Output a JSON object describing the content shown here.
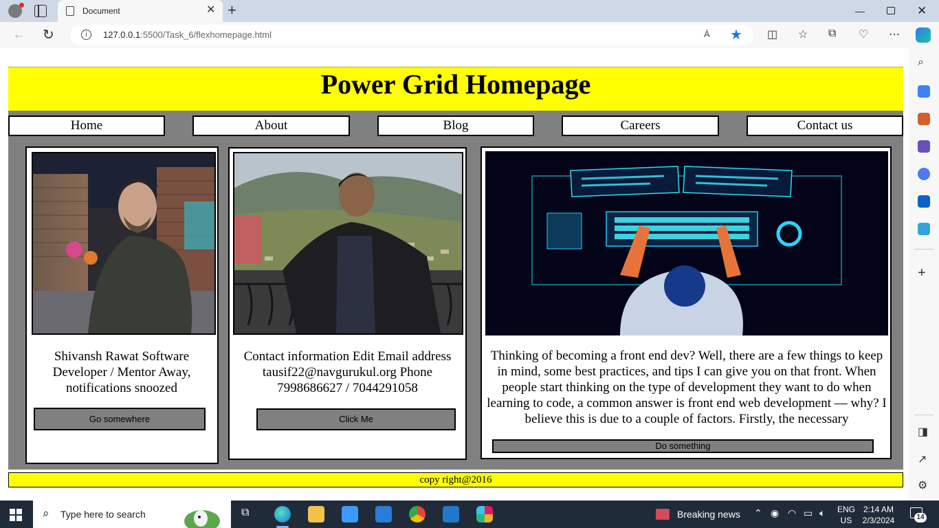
{
  "browser": {
    "tab_title": "Document",
    "url_host": "127.0.0.1",
    "url_rest": ":5500/Task_6/flexhomepage.html",
    "read_aloud_label": "Á"
  },
  "page": {
    "title": "Power Grid Homepage",
    "nav": [
      "Home",
      "About",
      "Blog",
      "Careers",
      "Contact us"
    ],
    "cards": [
      {
        "text": "Shivansh Rawat Software Developer / Mentor Away, notifications snoozed",
        "button": "Go somewhere",
        "image_alt": "man in dark sweater sitting on balcony at night"
      },
      {
        "text": "Contact information Edit Email address tausif22@navgurukul.org Phone 7998686627 / 7044291058",
        "button": "Click Me",
        "image_alt": "man standing on balcony with mountain valley behind"
      },
      {
        "text": "Thinking of becoming a front end dev? Well, there are a few things to keep in mind, some best practices, and tips I can give you on that front. When people start thinking on the type of development they want to do when learning to code, a common answer is front end web development — why? I believe this is due to a couple of factors. Firstly, the necessary",
        "button": "Do something",
        "image_alt": "illustration of developer at desk with keyboard and monitors"
      }
    ],
    "footer": "copy right@2016",
    "colors": {
      "header": "#ffff00",
      "grid": "#808080",
      "button": "#808080"
    }
  },
  "taskbar": {
    "search_placeholder": "Type here to search",
    "news": "Breaking news",
    "lang_line1": "ENG",
    "lang_line2": "US",
    "time": "2:14 AM",
    "date": "2/3/2024",
    "notifications": "14"
  }
}
